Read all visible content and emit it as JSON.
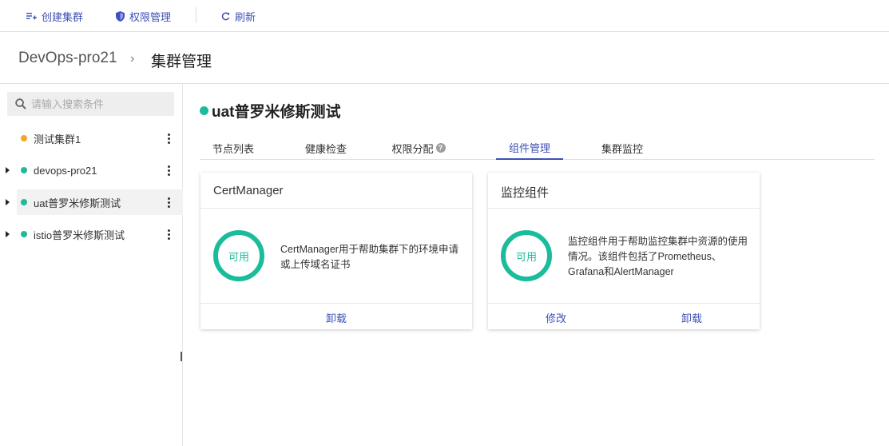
{
  "toolbar": {
    "create_label": "创建集群",
    "permission_label": "权限管理",
    "refresh_label": "刷新"
  },
  "breadcrumb": {
    "parent": "DevOps-pro21",
    "separator": "›",
    "current": "集群管理"
  },
  "sidebar": {
    "search_placeholder": "请输入搜索条件",
    "items": [
      {
        "label": "测试集群1",
        "status_color": "#f5a623",
        "expandable": false
      },
      {
        "label": "devops-pro21",
        "status_color": "#1abc9c",
        "expandable": true
      },
      {
        "label": "uat普罗米修斯测试",
        "status_color": "#1abc9c",
        "expandable": true,
        "selected": true
      },
      {
        "label": "istio普罗米修斯测试",
        "status_color": "#1abc9c",
        "expandable": true
      }
    ]
  },
  "main": {
    "cluster_name": "uat普罗米修斯测试",
    "tabs": [
      {
        "label": "节点列表"
      },
      {
        "label": "健康检查"
      },
      {
        "label": "权限分配"
      },
      {
        "label": "组件管理",
        "active": true
      },
      {
        "label": "集群监控"
      }
    ],
    "cards": [
      {
        "title": "CertManager",
        "status": "可用",
        "description": "CertManager用于帮助集群下的环境申请或上传域名证书",
        "actions": [
          "卸载"
        ]
      },
      {
        "title": "监控组件",
        "status": "可用",
        "description": "监控组件用于帮助监控集群中资源的使用情况。该组件包括了Prometheus、Grafana和AlertManager",
        "actions": [
          "修改",
          "卸载"
        ]
      }
    ]
  },
  "colors": {
    "accent": "#3f51b5",
    "available": "#1abc9c",
    "warning": "#f5a623"
  }
}
